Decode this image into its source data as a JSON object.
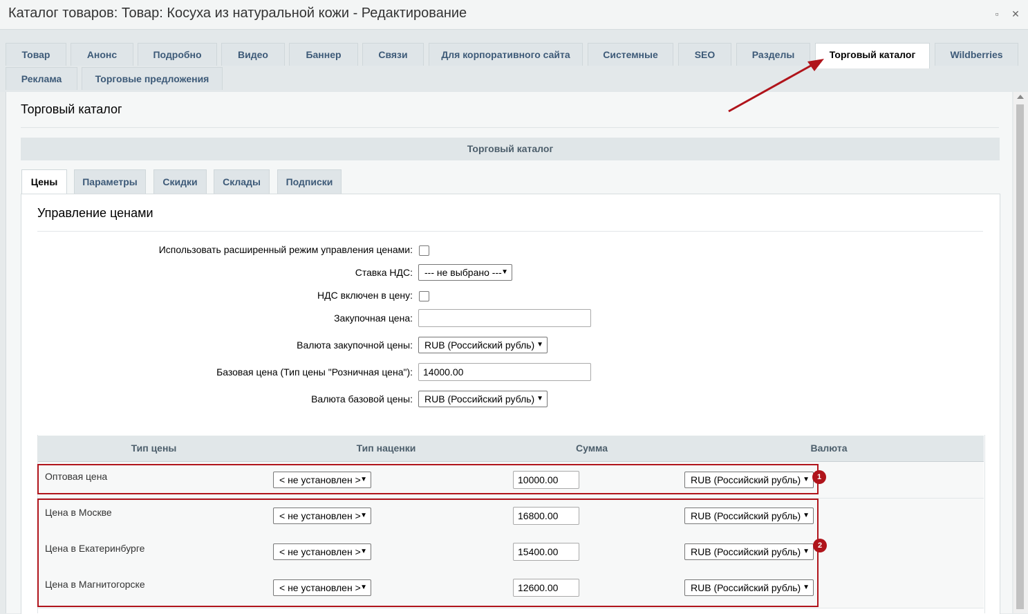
{
  "window": {
    "title": "Каталог товаров: Товар: Косуха из натуральной кожи - Редактирование"
  },
  "tabs": [
    {
      "label": "Товар"
    },
    {
      "label": "Анонс"
    },
    {
      "label": "Подробно"
    },
    {
      "label": "Видео"
    },
    {
      "label": "Баннер"
    },
    {
      "label": "Связи"
    },
    {
      "label": "Для корпоративного сайта"
    },
    {
      "label": "Системные"
    },
    {
      "label": "SEO"
    },
    {
      "label": "Разделы"
    },
    {
      "label": "Торговый каталог"
    },
    {
      "label": "Wildberries"
    },
    {
      "label": "Реклама"
    },
    {
      "label": "Торговые предложения"
    }
  ],
  "section": {
    "title": "Торговый каталог",
    "header": "Торговый каталог"
  },
  "subtabs": [
    {
      "label": "Цены"
    },
    {
      "label": "Параметры"
    },
    {
      "label": "Скидки"
    },
    {
      "label": "Склады"
    },
    {
      "label": "Подписки"
    }
  ],
  "panel": {
    "title": "Управление ценами"
  },
  "form": {
    "advanced_mode_label": "Использовать расширенный режим управления ценами:",
    "vat_rate_label": "Ставка НДС:",
    "vat_rate_value": "--- не выбрано ---",
    "vat_included_label": "НДС включен в цену:",
    "purchase_price_label": "Закупочная цена:",
    "purchase_price_value": "",
    "purchase_currency_label": "Валюта закупочной цены:",
    "purchase_currency_value": "RUB (Российский рубль)",
    "base_price_label": "Базовая цена (Тип цены \"Розничная цена\"):",
    "base_price_value": "14000.00",
    "base_currency_label": "Валюта базовой цены:",
    "base_currency_value": "RUB (Российский рубль)"
  },
  "price_table": {
    "headers": [
      "Тип цены",
      "Тип наценки",
      "Сумма",
      "Валюта"
    ],
    "rows": [
      {
        "type": "Оптовая цена",
        "markup": "< не установлен >",
        "sum": "10000.00",
        "currency": "RUB (Российский рубль)"
      },
      {
        "type": "Цена в Москве",
        "markup": "< не установлен >",
        "sum": "16800.00",
        "currency": "RUB (Российский рубль)"
      },
      {
        "type": "Цена в Екатеринбурге",
        "markup": "< не установлен >",
        "sum": "15400.00",
        "currency": "RUB (Российский рубль)"
      },
      {
        "type": "Цена в Магнитогорске",
        "markup": "< не установлен >",
        "sum": "12600.00",
        "currency": "RUB (Российский рубль)"
      }
    ]
  },
  "annotations": {
    "badge1": "1",
    "badge2": "2",
    "color": "#b0141b"
  }
}
